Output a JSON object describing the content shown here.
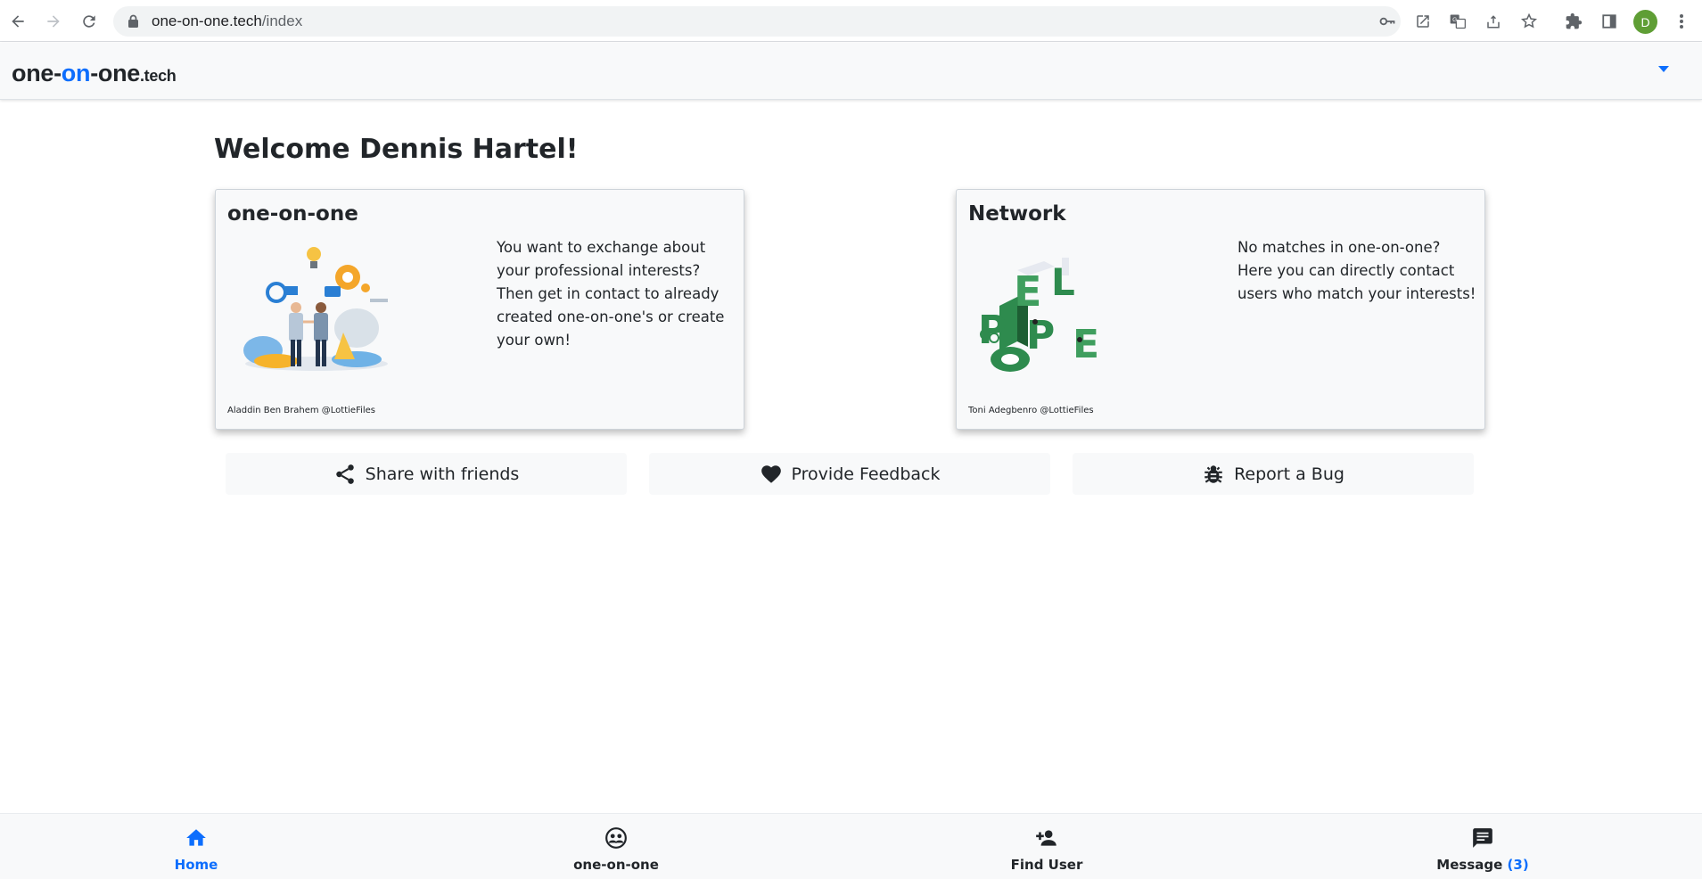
{
  "browser": {
    "url_host": "one-on-one.tech",
    "url_path": "/index",
    "profile_initial": "D",
    "profile_color": "#5f9e35"
  },
  "site": {
    "brand_one": "one-",
    "brand_on": "on",
    "brand_rest": "-one",
    "brand_tld": ".tech",
    "accent_color": "#0d6efd"
  },
  "main": {
    "welcome": "Welcome Dennis Hartel!",
    "cards": [
      {
        "title": "one-on-one",
        "text": "You want to exchange about your professional interests? Then get in contact to already created one-on-one's or create your own!",
        "credit": "Aladdin Ben Brahem @LottieFiles",
        "illustration": "business-handshake-illustration"
      },
      {
        "title": "Network",
        "text": "No matches in one-on-one? Here you can directly contact users who match your interests!",
        "credit": "Toni Adegbenro @LottieFiles",
        "illustration": "people-isometric-letters-illustration"
      }
    ],
    "actions": [
      {
        "label": "Share with friends",
        "icon": "share-icon"
      },
      {
        "label": "Provide Feedback",
        "icon": "heart-icon"
      },
      {
        "label": "Report a Bug",
        "icon": "bug-icon"
      }
    ]
  },
  "bottom_nav": {
    "tabs": [
      {
        "label": "Home",
        "icon": "home-icon",
        "active": true
      },
      {
        "label": "one-on-one",
        "icon": "groups-icon",
        "active": false
      },
      {
        "label": "Find User",
        "icon": "person-add-icon",
        "active": false
      },
      {
        "label": "Message",
        "count": "(3)",
        "icon": "message-icon",
        "active": false
      }
    ]
  }
}
